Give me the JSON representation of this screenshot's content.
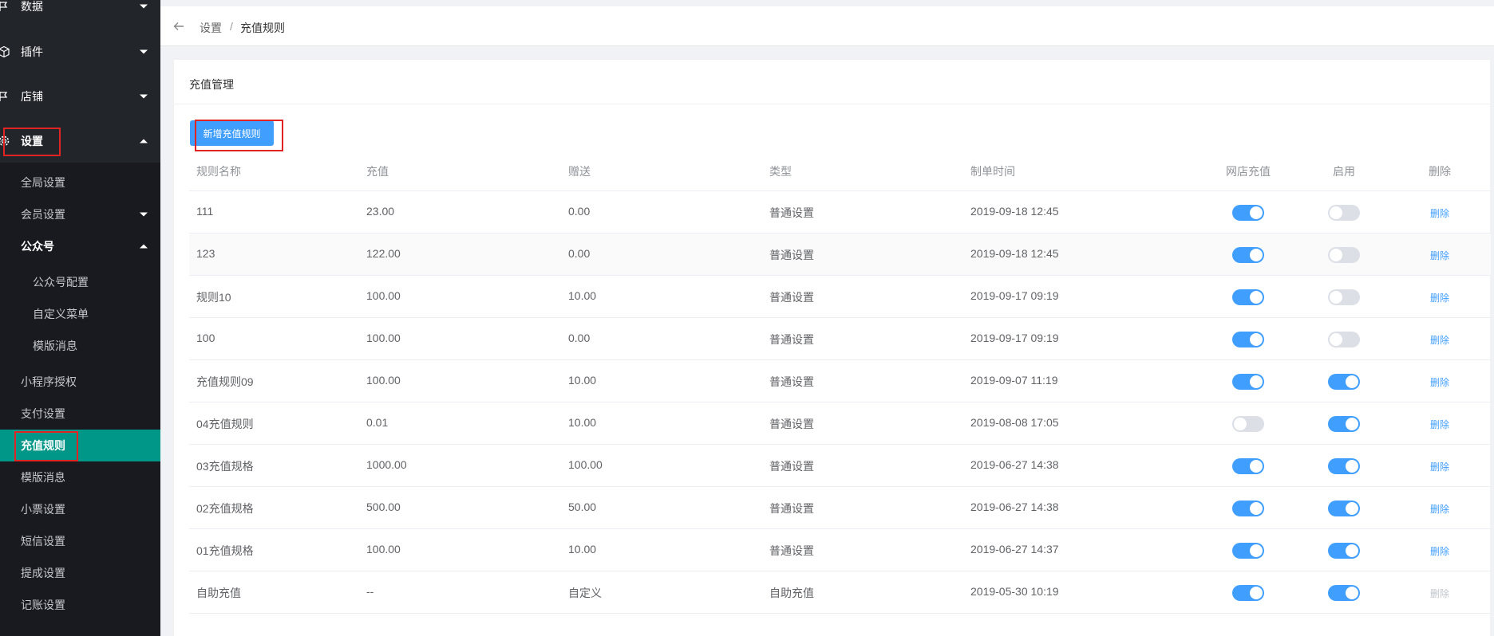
{
  "sidebar": {
    "top_items": [
      {
        "label": "数据",
        "icon": "flag-icon"
      },
      {
        "label": "插件",
        "icon": "cube-icon"
      },
      {
        "label": "店铺",
        "icon": "flag-icon"
      },
      {
        "label": "设置",
        "icon": "gear-icon"
      }
    ],
    "sub_items": [
      {
        "label": "全局设置"
      },
      {
        "label": "会员设置"
      },
      {
        "label": "公众号"
      },
      {
        "label": "公众号配置"
      },
      {
        "label": "自定义菜单"
      },
      {
        "label": "模版消息"
      },
      {
        "label": "小程序授权"
      },
      {
        "label": "支付设置"
      },
      {
        "label": "充值规则"
      },
      {
        "label": "模版消息"
      },
      {
        "label": "小票设置"
      },
      {
        "label": "短信设置"
      },
      {
        "label": "提成设置"
      },
      {
        "label": "记账设置"
      }
    ]
  },
  "breadcrumb": {
    "items": [
      "设置",
      "充值规则"
    ],
    "separator": "/"
  },
  "card": {
    "title": "充值管理",
    "add_button": "新增充值规则"
  },
  "table": {
    "headers": [
      "规则名称",
      "充值",
      "赠送",
      "类型",
      "制单时间",
      "网店充值",
      "启用",
      "删除"
    ],
    "rows": [
      {
        "name": "111",
        "recharge": "23.00",
        "gift": "0.00",
        "type": "普通设置",
        "time": "2019-09-18 12:45",
        "online": true,
        "enabled": false,
        "delete": "删除",
        "deletable": true
      },
      {
        "name": "123",
        "recharge": "122.00",
        "gift": "0.00",
        "type": "普通设置",
        "time": "2019-09-18 12:45",
        "online": true,
        "enabled": false,
        "delete": "删除",
        "deletable": true
      },
      {
        "name": "规则10",
        "recharge": "100.00",
        "gift": "10.00",
        "type": "普通设置",
        "time": "2019-09-17 09:19",
        "online": true,
        "enabled": false,
        "delete": "删除",
        "deletable": true
      },
      {
        "name": "100",
        "recharge": "100.00",
        "gift": "0.00",
        "type": "普通设置",
        "time": "2019-09-17 09:19",
        "online": true,
        "enabled": false,
        "delete": "删除",
        "deletable": true
      },
      {
        "name": "充值规则09",
        "recharge": "100.00",
        "gift": "10.00",
        "type": "普通设置",
        "time": "2019-09-07 11:19",
        "online": true,
        "enabled": true,
        "delete": "删除",
        "deletable": true
      },
      {
        "name": "04充值规则",
        "recharge": "0.01",
        "gift": "10.00",
        "type": "普通设置",
        "time": "2019-08-08 17:05",
        "online": false,
        "enabled": true,
        "delete": "删除",
        "deletable": true
      },
      {
        "name": "03充值规格",
        "recharge": "1000.00",
        "gift": "100.00",
        "type": "普通设置",
        "time": "2019-06-27 14:38",
        "online": true,
        "enabled": true,
        "delete": "删除",
        "deletable": true
      },
      {
        "name": "02充值规格",
        "recharge": "500.00",
        "gift": "50.00",
        "type": "普通设置",
        "time": "2019-06-27 14:38",
        "online": true,
        "enabled": true,
        "delete": "删除",
        "deletable": true
      },
      {
        "name": "01充值规格",
        "recharge": "100.00",
        "gift": "10.00",
        "type": "普通设置",
        "time": "2019-06-27 14:37",
        "online": true,
        "enabled": true,
        "delete": "删除",
        "deletable": true
      },
      {
        "name": "自助充值",
        "recharge": "--",
        "gift": "自定义",
        "type": "自助充值",
        "time": "2019-05-30 10:19",
        "online": true,
        "enabled": true,
        "delete": "删除",
        "deletable": false
      }
    ]
  },
  "colors": {
    "sidebar_bg": "#22252a",
    "sidebar_sub_bg": "#181a1f",
    "active_item": "#009688",
    "primary": "#409eff",
    "highlight_box": "#e02424"
  }
}
